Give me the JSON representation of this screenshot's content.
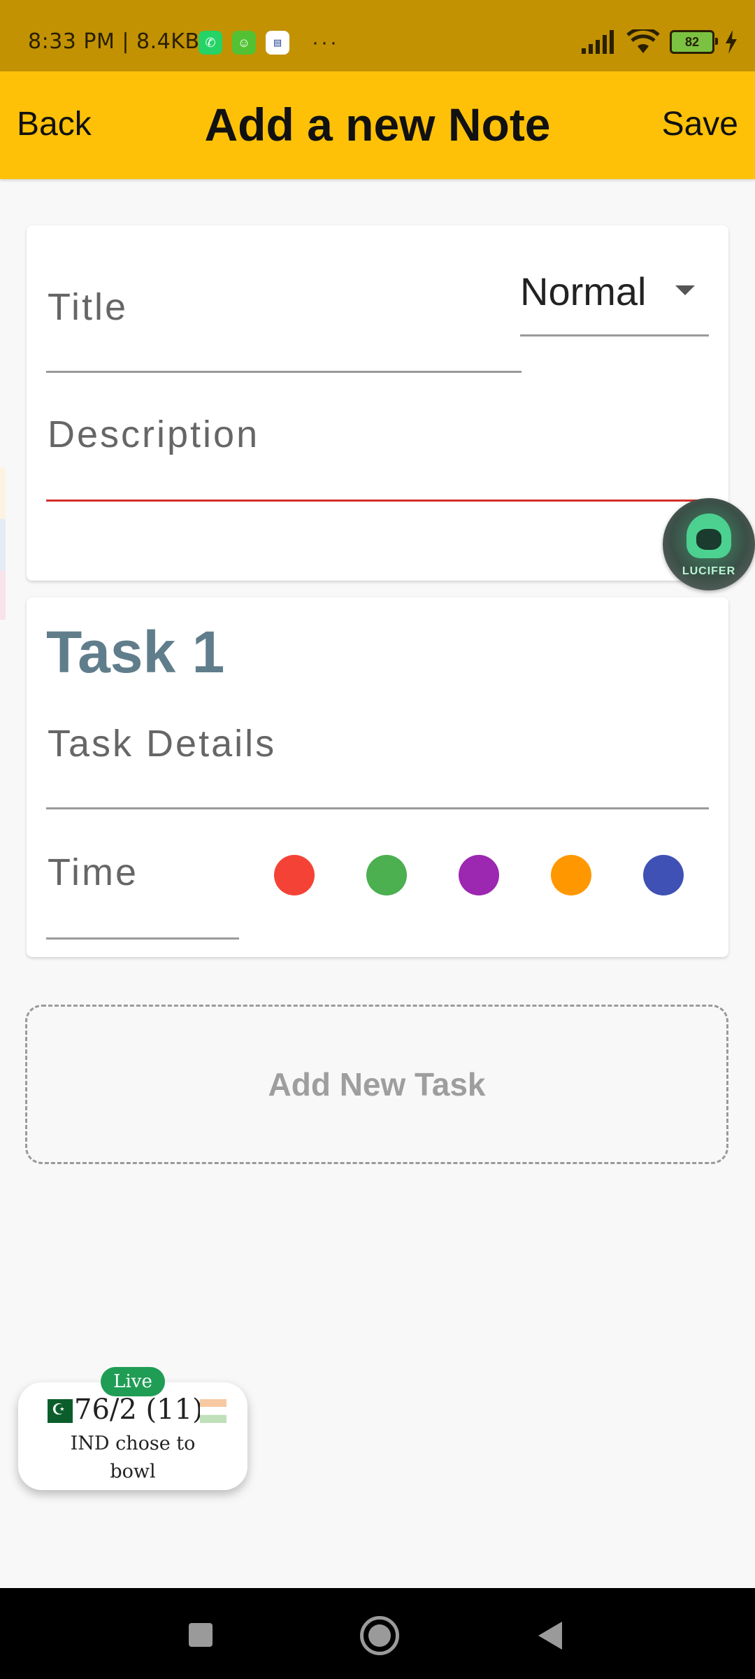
{
  "status_bar": {
    "time_speed": "8:33 PM | 8.4KB/s",
    "battery": "82",
    "more": "···",
    "apps": [
      "whatsapp-icon",
      "messenger-icon",
      "news-icon"
    ]
  },
  "app_bar": {
    "back_label": "Back",
    "title": "Add a new Note",
    "save_label": "Save"
  },
  "note_form": {
    "title_placeholder": "Title",
    "priority_value": "Normal",
    "description_placeholder": "Description"
  },
  "task": {
    "heading": "Task 1",
    "details_placeholder": "Task Details",
    "time_placeholder": "Time",
    "colors": [
      "#f44336",
      "#4caf50",
      "#9c27b0",
      "#ff9800",
      "#3f51b5"
    ]
  },
  "add_task_label": "Add New Task",
  "floating_avatar": {
    "name": "LUCIFER"
  },
  "score_widget": {
    "badge": "Live",
    "score": "76/2 (11)",
    "subtitle": "IND chose to bowl"
  }
}
